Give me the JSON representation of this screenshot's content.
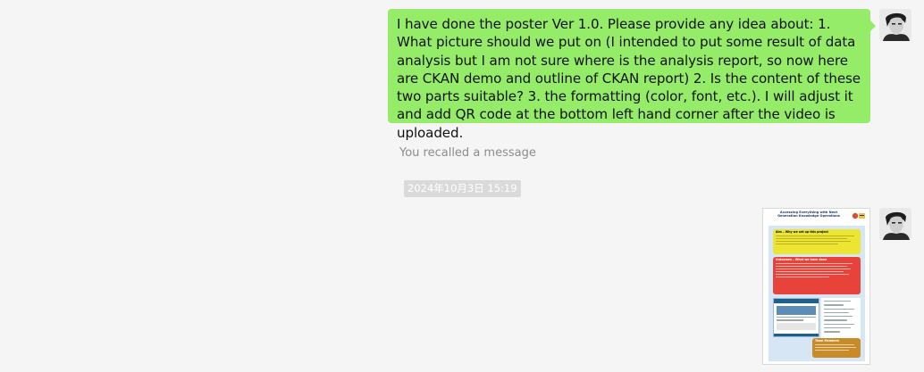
{
  "conversation": {
    "sent_message": {
      "text": "I have done the poster Ver 1.0. Please provide any idea about: 1. What picture should we put on (I intended to put some result of data analysis but I am not sure where is the analysis report, so now here are CKAN demo and outline of CKAN report) 2. Is the content of these two parts suitable? 3. the formatting (color, font, etc.). I will adjust it and add QR code at the bottom left hand corner after the video is uploaded."
    },
    "recall_notice": "You recalled a message",
    "timestamp": "2024年10月3日 15:19",
    "image_message": {
      "poster_title": "Accessing Everything with Next Generation Knowledge Operations",
      "sections": [
        {
          "heading": "Aim – Why we set up this project",
          "color": "#ece532"
        },
        {
          "heading": "Outcomes – What we have done",
          "color": "#e8433a"
        },
        {
          "heading": "Team Members",
          "color": "#c98a2a"
        }
      ]
    }
  },
  "colors": {
    "background": "#f5f5f5",
    "bubble": "#95ec69",
    "timestamp_bg": "#dadada",
    "recall_text": "#8c8c8c"
  }
}
